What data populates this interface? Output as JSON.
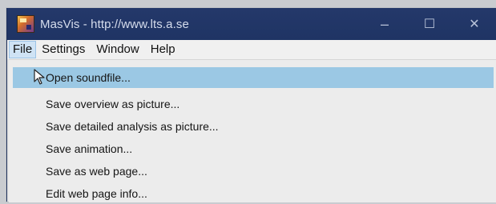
{
  "window": {
    "title": "MasVis - http://www.lts.a.se",
    "app_icon": "masvis-app-icon",
    "controls": {
      "minimize": "–",
      "maximize": "☐",
      "close": "✕"
    }
  },
  "menubar": {
    "items": [
      "File",
      "Settings",
      "Window",
      "Help"
    ],
    "active": "File"
  },
  "file_menu": {
    "items": [
      {
        "label": "Open soundfile...",
        "highlighted": true
      },
      {
        "label": "Save overview as picture..."
      },
      {
        "label": "Save detailed analysis as picture..."
      },
      {
        "label": "Save animation..."
      },
      {
        "label": "Save as web page..."
      },
      {
        "label": "Edit web page info..."
      }
    ]
  },
  "colors": {
    "titlebar": "#22376a",
    "menu_highlight": "#9bc8e4"
  }
}
